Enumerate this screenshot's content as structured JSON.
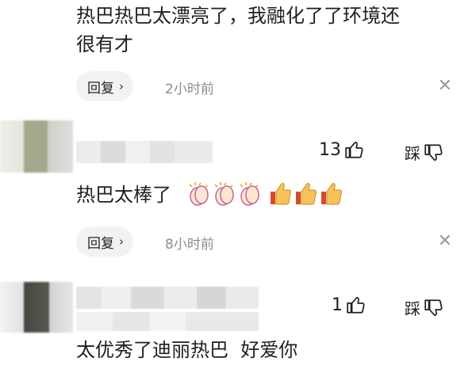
{
  "comments": [
    {
      "text": "热巴热巴太漂亮了，我融化了了环境还\n很有才",
      "reply_label": "回复",
      "time": "2小时前"
    },
    {
      "text": "热巴太棒了",
      "emojis": [
        "clap-emoji",
        "clap-emoji",
        "clap-emoji",
        "thumbs-up-emoji",
        "thumbs-up-emoji",
        "thumbs-up-emoji"
      ],
      "likes": "13",
      "dislike_label": "踩",
      "reply_label": "回复",
      "time": "8小时前"
    },
    {
      "text": "太优秀了迪丽热巴  好爱你",
      "likes": "1",
      "dislike_label": "踩"
    }
  ],
  "icons": {
    "close": "close-icon",
    "like": "thumbs-up-icon",
    "dislike": "thumbs-down-icon",
    "chevron": "chevron-right-icon"
  },
  "colors": {
    "pill_bg": "#f2f2f2",
    "time_text": "#8c8c8c"
  }
}
